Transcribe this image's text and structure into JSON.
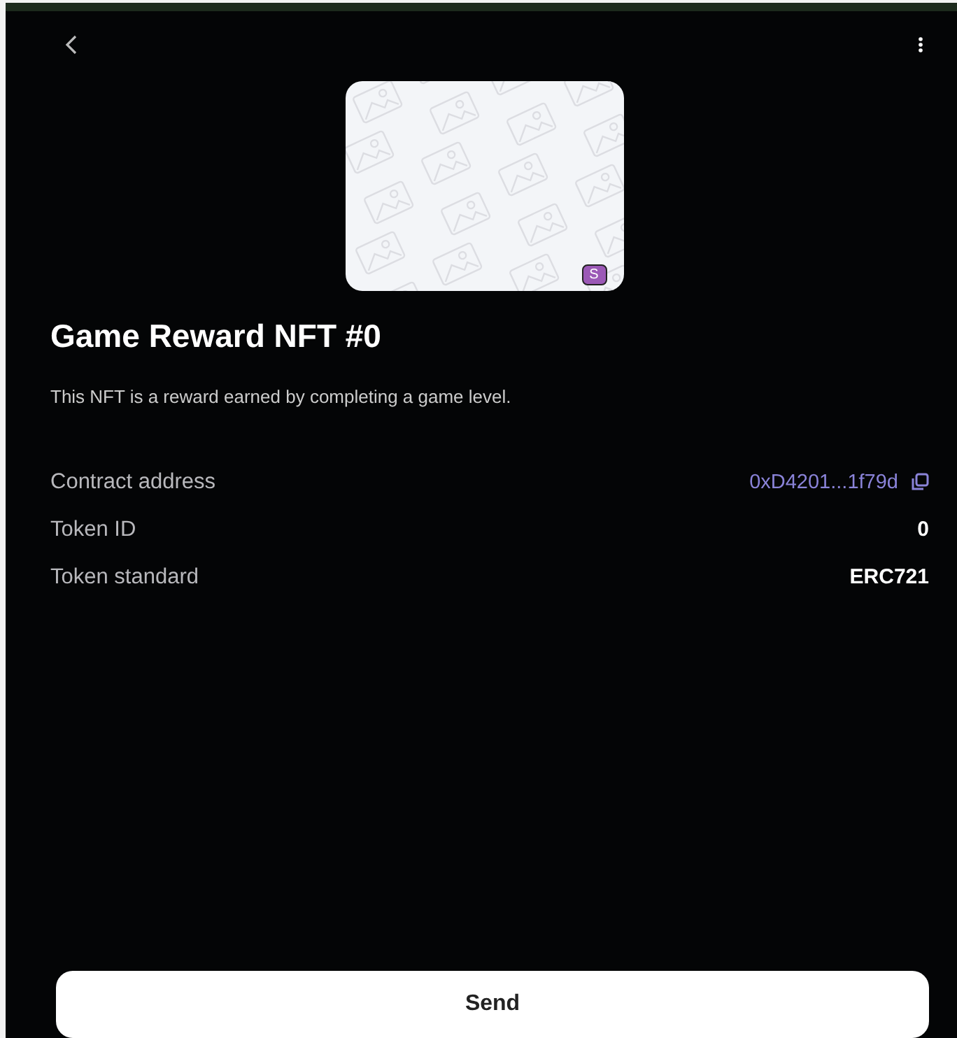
{
  "nft": {
    "badge": "S",
    "title": "Game Reward NFT #0",
    "description": "This NFT is a reward earned by completing a game level."
  },
  "details": [
    {
      "kind": "address",
      "label": "Contract address",
      "value": "0xD4201...1f79d"
    },
    {
      "kind": "text",
      "label": "Token ID",
      "value": "0"
    },
    {
      "kind": "text",
      "label": "Token standard",
      "value": "ERC721"
    }
  ],
  "buttons": [
    "Send"
  ]
}
